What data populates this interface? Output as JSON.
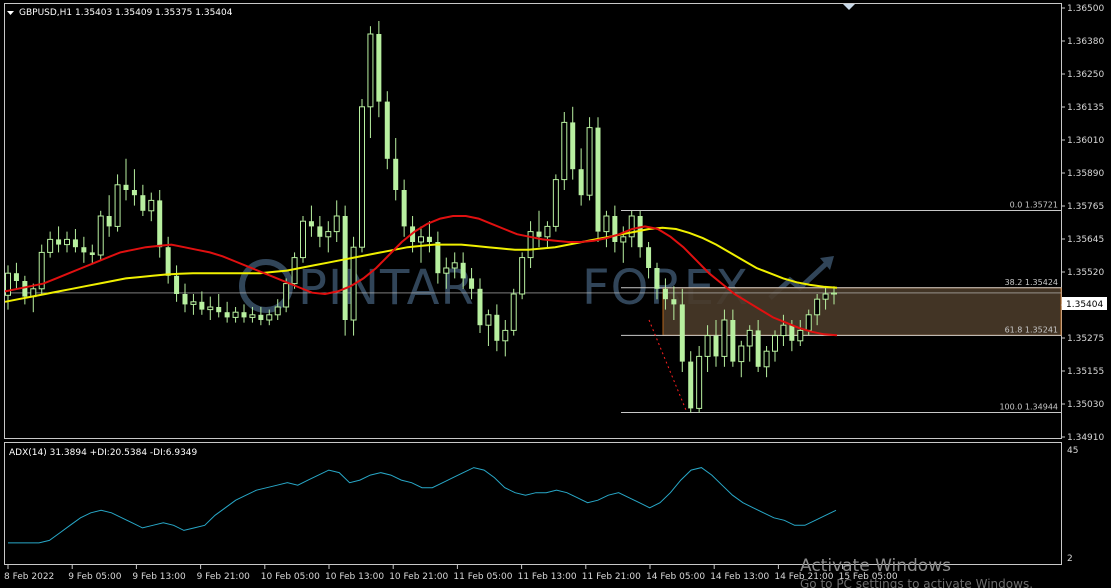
{
  "header": {
    "symbol_line": "GBPUSD,H1  1.35403 1.35409 1.35375 1.35404",
    "dropdown_arrow": "triangle-down-icon"
  },
  "watermark": {
    "prefix": "PINTAR",
    "suffix": "FOREX"
  },
  "activation": {
    "title": "Activate Windows",
    "subtitle": "Go to PC settings to activate Windows."
  },
  "colors": {
    "bull_candle": "#b8f0a0",
    "bear_candle": "#b8f0a0",
    "ma_red": "#e01010",
    "ma_yellow": "#f0f000",
    "adx_line": "#28a8c8",
    "grid_border": "#c8c8c8",
    "fib_line": "#c8c8c8",
    "fib_zone": "#4a3a2a",
    "fib_zone_border": "#c87020",
    "fib_dash": "#ff2020",
    "bid_line": "#c8c8c8"
  },
  "chart_data": {
    "type": "candlestick",
    "symbol": "GBPUSD",
    "timeframe": "H1",
    "ohlc_last": {
      "open": 1.35403,
      "high": 1.35409,
      "low": 1.35375,
      "close": 1.35404
    },
    "current_price_label": "1.35404",
    "price_axis_ticks": [
      "1.36500",
      "1.36380",
      "1.36250",
      "1.36135",
      "1.36010",
      "1.35890",
      "1.35765",
      "1.35645",
      "1.35520",
      "1.35404",
      "1.35275",
      "1.35155",
      "1.35030",
      "1.34910"
    ],
    "time_axis_ticks": [
      "8 Feb 2022",
      "9 Feb 05:00",
      "9 Feb 13:00",
      "9 Feb 21:00",
      "10 Feb 05:00",
      "10 Feb 13:00",
      "10 Feb 21:00",
      "11 Feb 05:00",
      "11 Feb 13:00",
      "11 Feb 21:00",
      "14 Feb 05:00",
      "14 Feb 13:00",
      "14 Feb 21:00",
      "15 Feb 05:00"
    ],
    "ylim": [
      1.3485,
      1.365
    ],
    "candles": [
      [
        1.35395,
        1.3551,
        1.3534,
        1.3548
      ],
      [
        1.3548,
        1.3552,
        1.3542,
        1.3545
      ],
      [
        1.3545,
        1.3547,
        1.3536,
        1.3539
      ],
      [
        1.3539,
        1.3544,
        1.3533,
        1.3542
      ],
      [
        1.3542,
        1.3559,
        1.354,
        1.3556
      ],
      [
        1.3556,
        1.3564,
        1.3554,
        1.3561
      ],
      [
        1.3561,
        1.3566,
        1.3556,
        1.3559
      ],
      [
        1.3559,
        1.3564,
        1.3556,
        1.3561
      ],
      [
        1.3561,
        1.3565,
        1.3556,
        1.3558
      ],
      [
        1.3558,
        1.3562,
        1.3552,
        1.3556
      ],
      [
        1.3556,
        1.3559,
        1.3552,
        1.3555
      ],
      [
        1.3555,
        1.3572,
        1.3553,
        1.357
      ],
      [
        1.357,
        1.3578,
        1.3562,
        1.3566
      ],
      [
        1.3566,
        1.3586,
        1.3564,
        1.3582
      ],
      [
        1.3582,
        1.3592,
        1.3576,
        1.358
      ],
      [
        1.358,
        1.3588,
        1.3574,
        1.3578
      ],
      [
        1.3578,
        1.3582,
        1.357,
        1.3572
      ],
      [
        1.3572,
        1.3579,
        1.3568,
        1.3576
      ],
      [
        1.3576,
        1.358,
        1.3554,
        1.3558
      ],
      [
        1.3558,
        1.3562,
        1.3544,
        1.3547
      ],
      [
        1.3547,
        1.3551,
        1.3537,
        1.354
      ],
      [
        1.354,
        1.3544,
        1.3533,
        1.3536
      ],
      [
        1.3536,
        1.354,
        1.3532,
        1.3537
      ],
      [
        1.3537,
        1.3541,
        1.3532,
        1.3534
      ],
      [
        1.3534,
        1.3539,
        1.353,
        1.3535
      ],
      [
        1.3535,
        1.354,
        1.3531,
        1.3533
      ],
      [
        1.3533,
        1.3537,
        1.3529,
        1.3531
      ],
      [
        1.3531,
        1.3535,
        1.3529,
        1.3533
      ],
      [
        1.3533,
        1.3536,
        1.3529,
        1.3531
      ],
      [
        1.3531,
        1.3535,
        1.3529,
        1.3532
      ],
      [
        1.3532,
        1.3535,
        1.3528,
        1.353
      ],
      [
        1.353,
        1.3534,
        1.3528,
        1.3532
      ],
      [
        1.3532,
        1.3538,
        1.353,
        1.3535
      ],
      [
        1.3535,
        1.3546,
        1.3533,
        1.3544
      ],
      [
        1.3544,
        1.3556,
        1.3542,
        1.3554
      ],
      [
        1.3554,
        1.357,
        1.3552,
        1.3568
      ],
      [
        1.3568,
        1.3574,
        1.3562,
        1.3566
      ],
      [
        1.3566,
        1.357,
        1.3558,
        1.3562
      ],
      [
        1.3562,
        1.3568,
        1.3556,
        1.3564
      ],
      [
        1.3564,
        1.3576,
        1.356,
        1.357
      ],
      [
        1.357,
        1.3574,
        1.3524,
        1.353
      ],
      [
        1.353,
        1.3562,
        1.3524,
        1.3558
      ],
      [
        1.3558,
        1.3615,
        1.3556,
        1.3612
      ],
      [
        1.3612,
        1.3643,
        1.36,
        1.364
      ],
      [
        1.364,
        1.3645,
        1.3608,
        1.3614
      ],
      [
        1.3614,
        1.3618,
        1.3588,
        1.3592
      ],
      [
        1.3592,
        1.36,
        1.3576,
        1.358
      ],
      [
        1.358,
        1.3584,
        1.3562,
        1.3566
      ],
      [
        1.3566,
        1.357,
        1.3556,
        1.356
      ],
      [
        1.356,
        1.3566,
        1.3552,
        1.3562
      ],
      [
        1.3562,
        1.3568,
        1.3556,
        1.356
      ],
      [
        1.356,
        1.3564,
        1.3544,
        1.3548
      ],
      [
        1.3548,
        1.3554,
        1.3542,
        1.355
      ],
      [
        1.355,
        1.3556,
        1.3546,
        1.3552
      ],
      [
        1.3552,
        1.3556,
        1.3542,
        1.3546
      ],
      [
        1.3546,
        1.355,
        1.3538,
        1.3542
      ],
      [
        1.3542,
        1.3546,
        1.3525,
        1.3528
      ],
      [
        1.3528,
        1.3534,
        1.352,
        1.3532
      ],
      [
        1.3532,
        1.3536,
        1.3518,
        1.3522
      ],
      [
        1.3522,
        1.353,
        1.3516,
        1.3526
      ],
      [
        1.3526,
        1.3542,
        1.3524,
        1.354
      ],
      [
        1.354,
        1.3556,
        1.3538,
        1.3554
      ],
      [
        1.3554,
        1.3568,
        1.355,
        1.3564
      ],
      [
        1.3564,
        1.3572,
        1.3558,
        1.3562
      ],
      [
        1.3562,
        1.3568,
        1.3558,
        1.3566
      ],
      [
        1.3566,
        1.3586,
        1.3564,
        1.3584
      ],
      [
        1.3584,
        1.361,
        1.358,
        1.3606
      ],
      [
        1.3606,
        1.3612,
        1.3584,
        1.3588
      ],
      [
        1.3588,
        1.3596,
        1.3574,
        1.3578
      ],
      [
        1.3578,
        1.3608,
        1.3576,
        1.3604
      ],
      [
        1.3604,
        1.3608,
        1.356,
        1.3564
      ],
      [
        1.3564,
        1.3572,
        1.3558,
        1.357
      ],
      [
        1.357,
        1.3574,
        1.3556,
        1.356
      ],
      [
        1.356,
        1.3566,
        1.3552,
        1.3562
      ],
      [
        1.3562,
        1.3572,
        1.3558,
        1.357
      ],
      [
        1.357,
        1.3572,
        1.3554,
        1.3558
      ],
      [
        1.3558,
        1.356,
        1.3546,
        1.355
      ],
      [
        1.355,
        1.3552,
        1.3538,
        1.3542
      ],
      [
        1.3542,
        1.3546,
        1.3534,
        1.3538
      ],
      [
        1.3538,
        1.3543,
        1.353,
        1.3536
      ],
      [
        1.3536,
        1.3542,
        1.351,
        1.3514
      ],
      [
        1.3514,
        1.3518,
        1.34944,
        1.3496
      ],
      [
        1.3496,
        1.352,
        1.34944,
        1.3516
      ],
      [
        1.3516,
        1.3528,
        1.351,
        1.3524
      ],
      [
        1.3524,
        1.353,
        1.3512,
        1.3516
      ],
      [
        1.3516,
        1.3534,
        1.3512,
        1.353
      ],
      [
        1.353,
        1.3534,
        1.3512,
        1.3514
      ],
      [
        1.3514,
        1.3522,
        1.3508,
        1.352
      ],
      [
        1.352,
        1.3528,
        1.3514,
        1.3526
      ],
      [
        1.3526,
        1.353,
        1.351,
        1.3512
      ],
      [
        1.3512,
        1.352,
        1.3508,
        1.3518
      ],
      [
        1.3518,
        1.3526,
        1.3514,
        1.3524
      ],
      [
        1.3524,
        1.3532,
        1.352,
        1.3528
      ],
      [
        1.3528,
        1.353,
        1.3518,
        1.3522
      ],
      [
        1.3522,
        1.353,
        1.352,
        1.3526
      ],
      [
        1.3526,
        1.3534,
        1.3524,
        1.3532
      ],
      [
        1.3532,
        1.354,
        1.3528,
        1.3538
      ],
      [
        1.3538,
        1.3543,
        1.3534,
        1.354
      ],
      [
        1.354,
        1.3543,
        1.3536,
        1.35404
      ]
    ],
    "ma_red": [
      1.3541,
      1.3542,
      1.3543,
      1.3544,
      1.3546,
      1.3548,
      1.355,
      1.3552,
      1.3554,
      1.3556,
      1.3557,
      1.3558,
      1.35585,
      1.3559,
      1.3558,
      1.3557,
      1.3556,
      1.35545,
      1.35525,
      1.35505,
      1.35485,
      1.35465,
      1.35445,
      1.35425,
      1.35405,
      1.354,
      1.3541,
      1.3543,
      1.3546,
      1.355,
      1.3555,
      1.356,
      1.3564,
      1.3567,
      1.3569,
      1.357,
      1.357,
      1.3569,
      1.3567,
      1.3565,
      1.3563,
      1.3562,
      1.3561,
      1.35605,
      1.356,
      1.356,
      1.35605,
      1.35615,
      1.3563,
      1.3565,
      1.3566,
      1.3565,
      1.3562,
      1.3558,
      1.3553,
      1.3548,
      1.3544,
      1.354,
      1.3537,
      1.3534,
      1.3531,
      1.3529,
      1.3527,
      1.35255,
      1.35245,
      1.35241
    ],
    "ma_yellow": [
      1.3537,
      1.3538,
      1.3539,
      1.354,
      1.3541,
      1.3542,
      1.3543,
      1.3544,
      1.3545,
      1.3546,
      1.35465,
      1.3547,
      1.35475,
      1.35478,
      1.3548,
      1.3548,
      1.3548,
      1.3548,
      1.3548,
      1.3548,
      1.35485,
      1.3549,
      1.355,
      1.3551,
      1.3552,
      1.3553,
      1.3554,
      1.3555,
      1.3556,
      1.3557,
      1.3558,
      1.35585,
      1.3559,
      1.3559,
      1.3559,
      1.35585,
      1.3558,
      1.35575,
      1.3557,
      1.3557,
      1.35575,
      1.3558,
      1.3559,
      1.356,
      1.3561,
      1.3562,
      1.3563,
      1.3564,
      1.3565,
      1.35655,
      1.3565,
      1.35635,
      1.35615,
      1.3559,
      1.3556,
      1.3553,
      1.355,
      1.3548,
      1.3546,
      1.35445,
      1.35435,
      1.35428,
      1.35424
    ],
    "fibonacci": [
      {
        "label": "0.0 1.35721",
        "price": 1.35721
      },
      {
        "label": "38.2 1.35424",
        "price": 1.35424
      },
      {
        "label": "61.8 1.35241",
        "price": 1.35241
      },
      {
        "label": "100.0 1.34944",
        "price": 1.34944
      }
    ],
    "adx": {
      "label": "ADX(14) 31.3894 +DI:20.5384 -DI:6.9349",
      "scale_max": "45",
      "scale_min": "2",
      "ylim": [
        2,
        45
      ],
      "values": [
        8,
        8,
        8,
        8,
        9,
        12,
        15,
        18,
        20,
        21,
        20,
        18,
        16,
        14,
        15,
        16,
        15,
        13,
        14,
        15,
        19,
        22,
        25,
        27,
        29,
        30,
        31,
        32,
        31,
        33,
        35,
        37,
        36,
        32,
        33,
        35,
        36,
        35,
        33,
        32,
        30,
        30,
        32,
        34,
        36,
        38,
        37,
        34,
        30,
        28,
        27,
        28,
        28,
        29,
        28,
        26,
        24,
        25,
        27,
        28,
        26,
        24,
        22,
        24,
        28,
        33,
        37,
        38,
        35,
        31,
        27,
        24,
        22,
        20,
        18,
        17,
        15,
        15,
        17,
        19,
        21
      ]
    }
  }
}
